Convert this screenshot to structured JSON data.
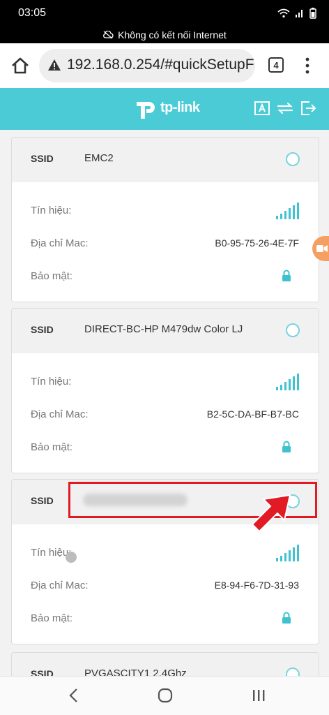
{
  "status": {
    "time": "03:05"
  },
  "network_notice": "Không có kết nối Internet",
  "browser": {
    "url": "192.168.0.254/#quickSetupF",
    "tab_count": "4"
  },
  "brand": {
    "logo_text": "tp-link"
  },
  "labels": {
    "ssid": "SSID",
    "signal": "Tín hiệu:",
    "mac": "Địa chỉ Mac:",
    "security": "Bảo mật:"
  },
  "networks": [
    {
      "ssid": "EMC2",
      "mac": "B0-95-75-26-4E-7F"
    },
    {
      "ssid": "DIRECT-BC-HP M479dw Color LJ",
      "mac": "B2-5C-DA-BF-B7-BC"
    },
    {
      "ssid": "",
      "mac": "E8-94-F6-7D-31-93"
    },
    {
      "ssid": "PVGASCITY1 2.4Ghz",
      "mac": ""
    }
  ],
  "colors": {
    "accent": "#4acbd6",
    "highlight": "#e01b24",
    "signal": "#3ec2cf"
  },
  "icons": [
    "home-icon",
    "warning-icon",
    "more-icon",
    "signal-icon",
    "lock-icon",
    "back-icon",
    "home-nav-icon",
    "recents-icon"
  ]
}
